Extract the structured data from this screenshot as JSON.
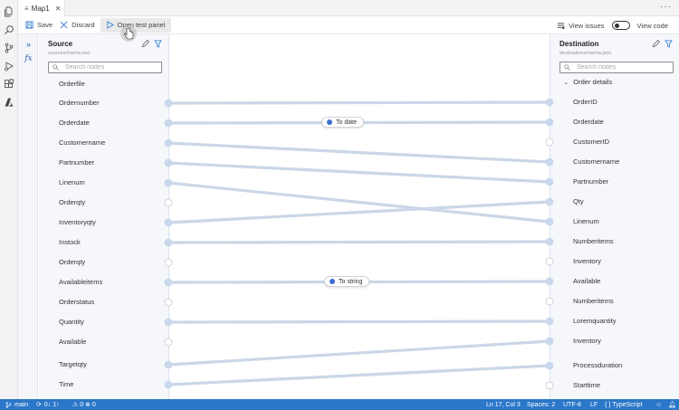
{
  "tab": {
    "title": "Map1"
  },
  "toolbar": {
    "save": "Save",
    "discard": "Discard",
    "open_test_panel": "Open test panel",
    "view_issues": "View issues",
    "view_code": "View code"
  },
  "source": {
    "title": "Source",
    "schema": "sourceschema.xsd",
    "search_placeholder": "Search nodes",
    "nodes": [
      "Orderfile",
      "Ordernumber",
      "Orderdate",
      "Customername",
      "Partnumber",
      "Linenum",
      "Orderqty",
      "Inventoryqty",
      "Instock",
      "Orderqty",
      "Availableitems",
      "Orderstatus",
      "Quantity",
      "Available",
      "Targetqty",
      "Time"
    ]
  },
  "destination": {
    "title": "Destination",
    "schema": "destinationschema.json",
    "search_placeholder": "Search nodes",
    "group": "Order details",
    "nodes": [
      "OrderID",
      "Orderdate",
      "CustomerID",
      "Customername",
      "Partnumber",
      "Qty",
      "Linenum",
      "Numberitems",
      "Inventory",
      "Available",
      "Numberitems",
      "Loremquantity",
      "Inventory",
      "Processduration",
      "Starttime"
    ]
  },
  "functions": [
    {
      "label": "To date"
    },
    {
      "label": "To string"
    }
  ],
  "status": {
    "branch": "main",
    "sync": "0↓ 1↑",
    "problems": "⚠ 0  ⊗ 0",
    "position": "Ln 17, Col 3",
    "spaces": "Spaces: 2",
    "encoding": "UTF-8",
    "eol": "LF",
    "language": "{ } TypeScript"
  },
  "colors": {
    "accent": "#2b77c9",
    "link": "#cbd7e6",
    "connector": "#c9d8ec",
    "function_dot": "#3b6fd0"
  }
}
